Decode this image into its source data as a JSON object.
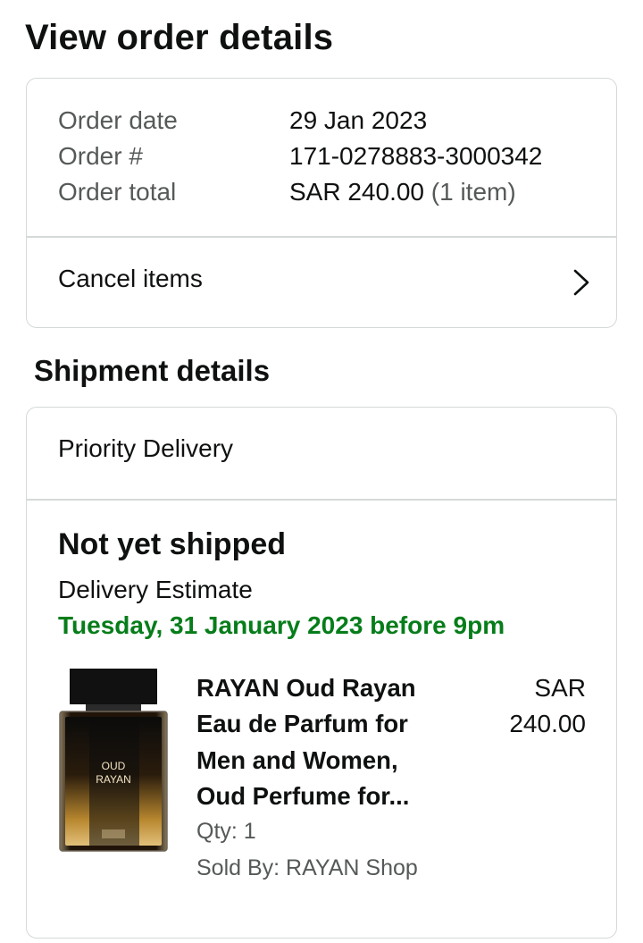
{
  "page": {
    "title": "View order details"
  },
  "order_summary": {
    "rows": [
      {
        "label": "Order date",
        "value": "29 Jan 2023"
      },
      {
        "label": "Order #",
        "value": "171-0278883-3000342"
      },
      {
        "label": "Order total",
        "value": "SAR 240.00",
        "value_suffix": "(1 item)"
      }
    ],
    "cancel_label": "Cancel items",
    "cancel_icon": "chevron-right-icon"
  },
  "shipment": {
    "section_title": "Shipment details",
    "delivery_type": "Priority Delivery",
    "status": "Not yet shipped",
    "estimate_label": "Delivery Estimate",
    "estimate_date": "Tuesday, 31 January 2023 before 9pm",
    "estimate_color": "#067d1a",
    "item": {
      "title": "RAYAN Oud Rayan Eau de Parfum for Men and Women, Oud Perfume for...",
      "price_currency": "SAR",
      "price_amount": "240.00",
      "qty": "Qty: 1",
      "sold_by": "Sold By: RAYAN Shop",
      "image_label_line1": "OUD",
      "image_label_line2": "RAYAN",
      "image_icon": "perfume-bottle-image"
    }
  }
}
